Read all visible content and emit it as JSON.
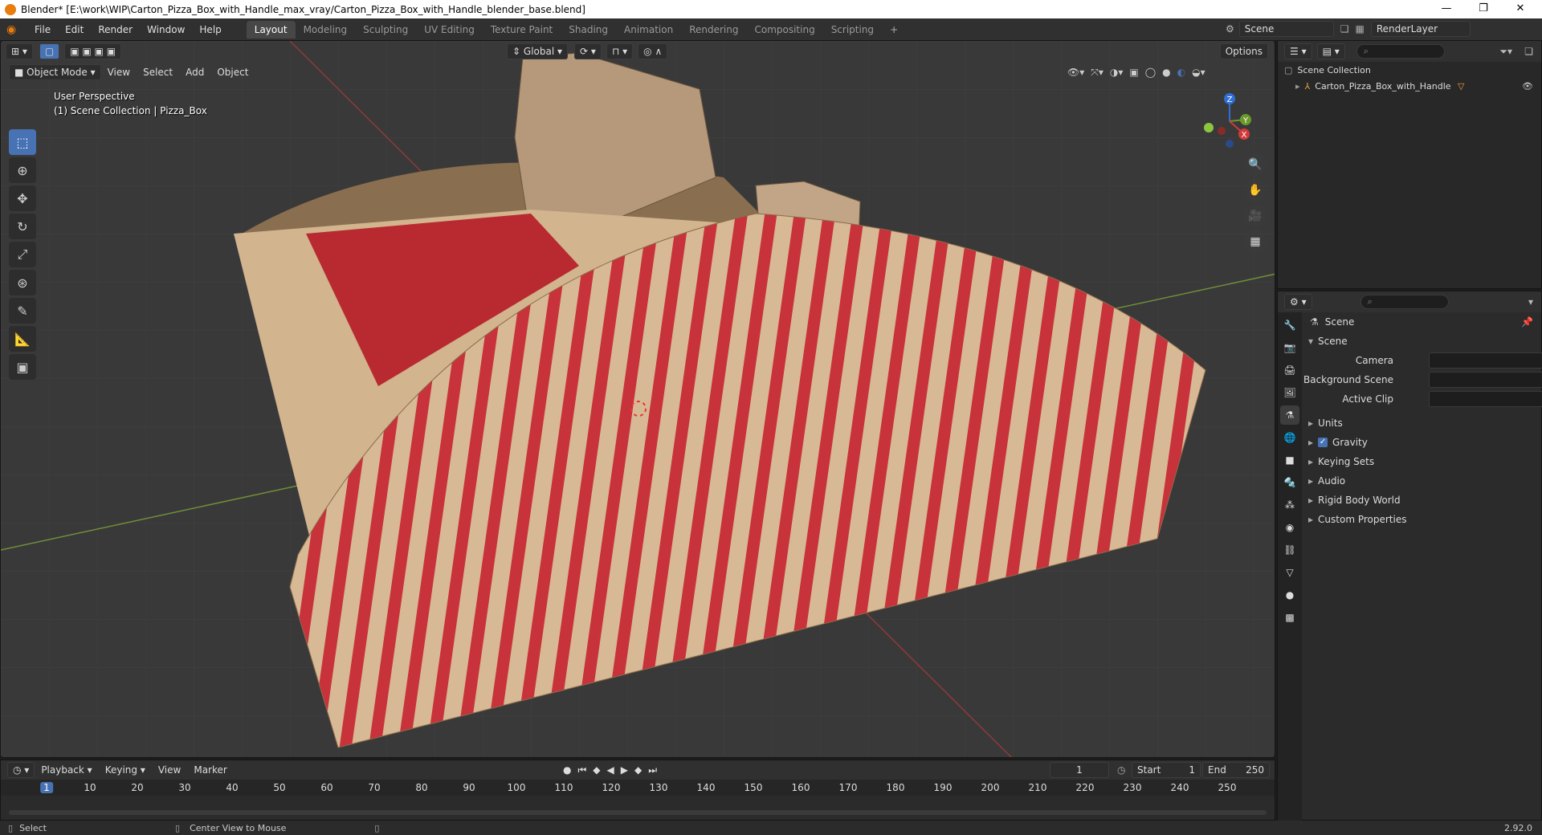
{
  "window": {
    "title": "Blender* [E:\\work\\WIP\\Carton_Pizza_Box_with_Handle_max_vray/Carton_Pizza_Box_with_Handle_blender_base.blend]",
    "minimize": "—",
    "restore": "❐",
    "close": "✕"
  },
  "menubar": [
    "File",
    "Edit",
    "Render",
    "Window",
    "Help"
  ],
  "workspaces": [
    "Layout",
    "Modeling",
    "Sculpting",
    "UV Editing",
    "Texture Paint",
    "Shading",
    "Animation",
    "Rendering",
    "Compositing",
    "Scripting"
  ],
  "add_workspace": "+",
  "scene_name": "Scene",
  "render_layer": "RenderLayer",
  "viewport": {
    "transform_orientation": "Global",
    "options": "Options",
    "mode": "Object Mode",
    "menus": [
      "View",
      "Select",
      "Add",
      "Object"
    ],
    "perspective": "User Perspective",
    "collection_info": "(1) Scene Collection | Pizza_Box",
    "gizmo_axes": [
      "X",
      "Y",
      "Z"
    ]
  },
  "outliner": {
    "root": "Scene Collection",
    "items": [
      {
        "name": "Carton_Pizza_Box_with_Handle"
      }
    ]
  },
  "properties": {
    "context": "Scene",
    "panel": "Scene",
    "fields": [
      {
        "label": "Camera",
        "value": ""
      },
      {
        "label": "Background Scene",
        "value": ""
      },
      {
        "label": "Active Clip",
        "value": ""
      }
    ],
    "subpanels": [
      {
        "label": "Units",
        "checkbox": false
      },
      {
        "label": "Gravity",
        "checkbox": true
      },
      {
        "label": "Keying Sets",
        "checkbox": false
      },
      {
        "label": "Audio",
        "checkbox": false
      },
      {
        "label": "Rigid Body World",
        "checkbox": false
      },
      {
        "label": "Custom Properties",
        "checkbox": false
      }
    ]
  },
  "timeline": {
    "menus": [
      "Playback",
      "Keying",
      "View",
      "Marker"
    ],
    "current_frame": "1",
    "start_label": "Start",
    "start": "1",
    "end_label": "End",
    "end": "250",
    "ticks": [
      "10",
      "20",
      "30",
      "40",
      "50",
      "60",
      "70",
      "80",
      "90",
      "100",
      "110",
      "120",
      "130",
      "140",
      "150",
      "160",
      "170",
      "180",
      "190",
      "200",
      "210",
      "220",
      "230",
      "240",
      "250"
    ],
    "playhead": "1"
  },
  "statusbar": {
    "left": "Select",
    "middle": "Center View to Mouse",
    "version": "2.92.0"
  },
  "colors": {
    "accent": "#4772b3",
    "stripe_red": "#c8323a",
    "cardboard": "#d7b995"
  }
}
